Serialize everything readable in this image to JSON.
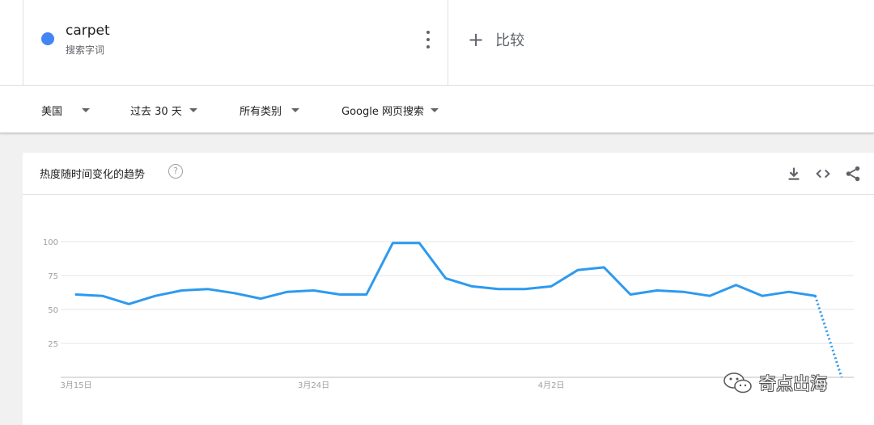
{
  "term": {
    "title": "carpet",
    "subtitle": "搜索字词",
    "dot_color": "#4285f4"
  },
  "compare": {
    "plus": "+",
    "label": "比较"
  },
  "filters": [
    {
      "label": "美国"
    },
    {
      "label": "过去 30 天"
    },
    {
      "label": "所有类别"
    },
    {
      "label": "Google 网页搜索"
    }
  ],
  "card": {
    "title": "热度随时间变化的趋势",
    "help": "?",
    "icons": [
      "download-icon",
      "embed-icon",
      "share-icon"
    ]
  },
  "chart_data": {
    "type": "line",
    "ylim": [
      0,
      100
    ],
    "yticks": [
      100,
      75,
      50,
      25
    ],
    "xtick_labels": [
      {
        "label": "3月15日",
        "index": 0
      },
      {
        "label": "3月24日",
        "index": 9
      },
      {
        "label": "4月2日",
        "index": 18
      }
    ],
    "series": [
      {
        "color": "#2d9aef",
        "values": [
          61,
          60,
          54,
          60,
          64,
          65,
          62,
          58,
          63,
          64,
          61,
          61,
          99,
          99,
          73,
          67,
          65,
          65,
          67,
          79,
          81,
          61,
          64,
          63,
          60,
          68,
          60,
          63,
          60,
          0
        ],
        "dotted_from_index": 28
      }
    ],
    "grid": true
  },
  "watermark": {
    "text": "奇点出海"
  }
}
